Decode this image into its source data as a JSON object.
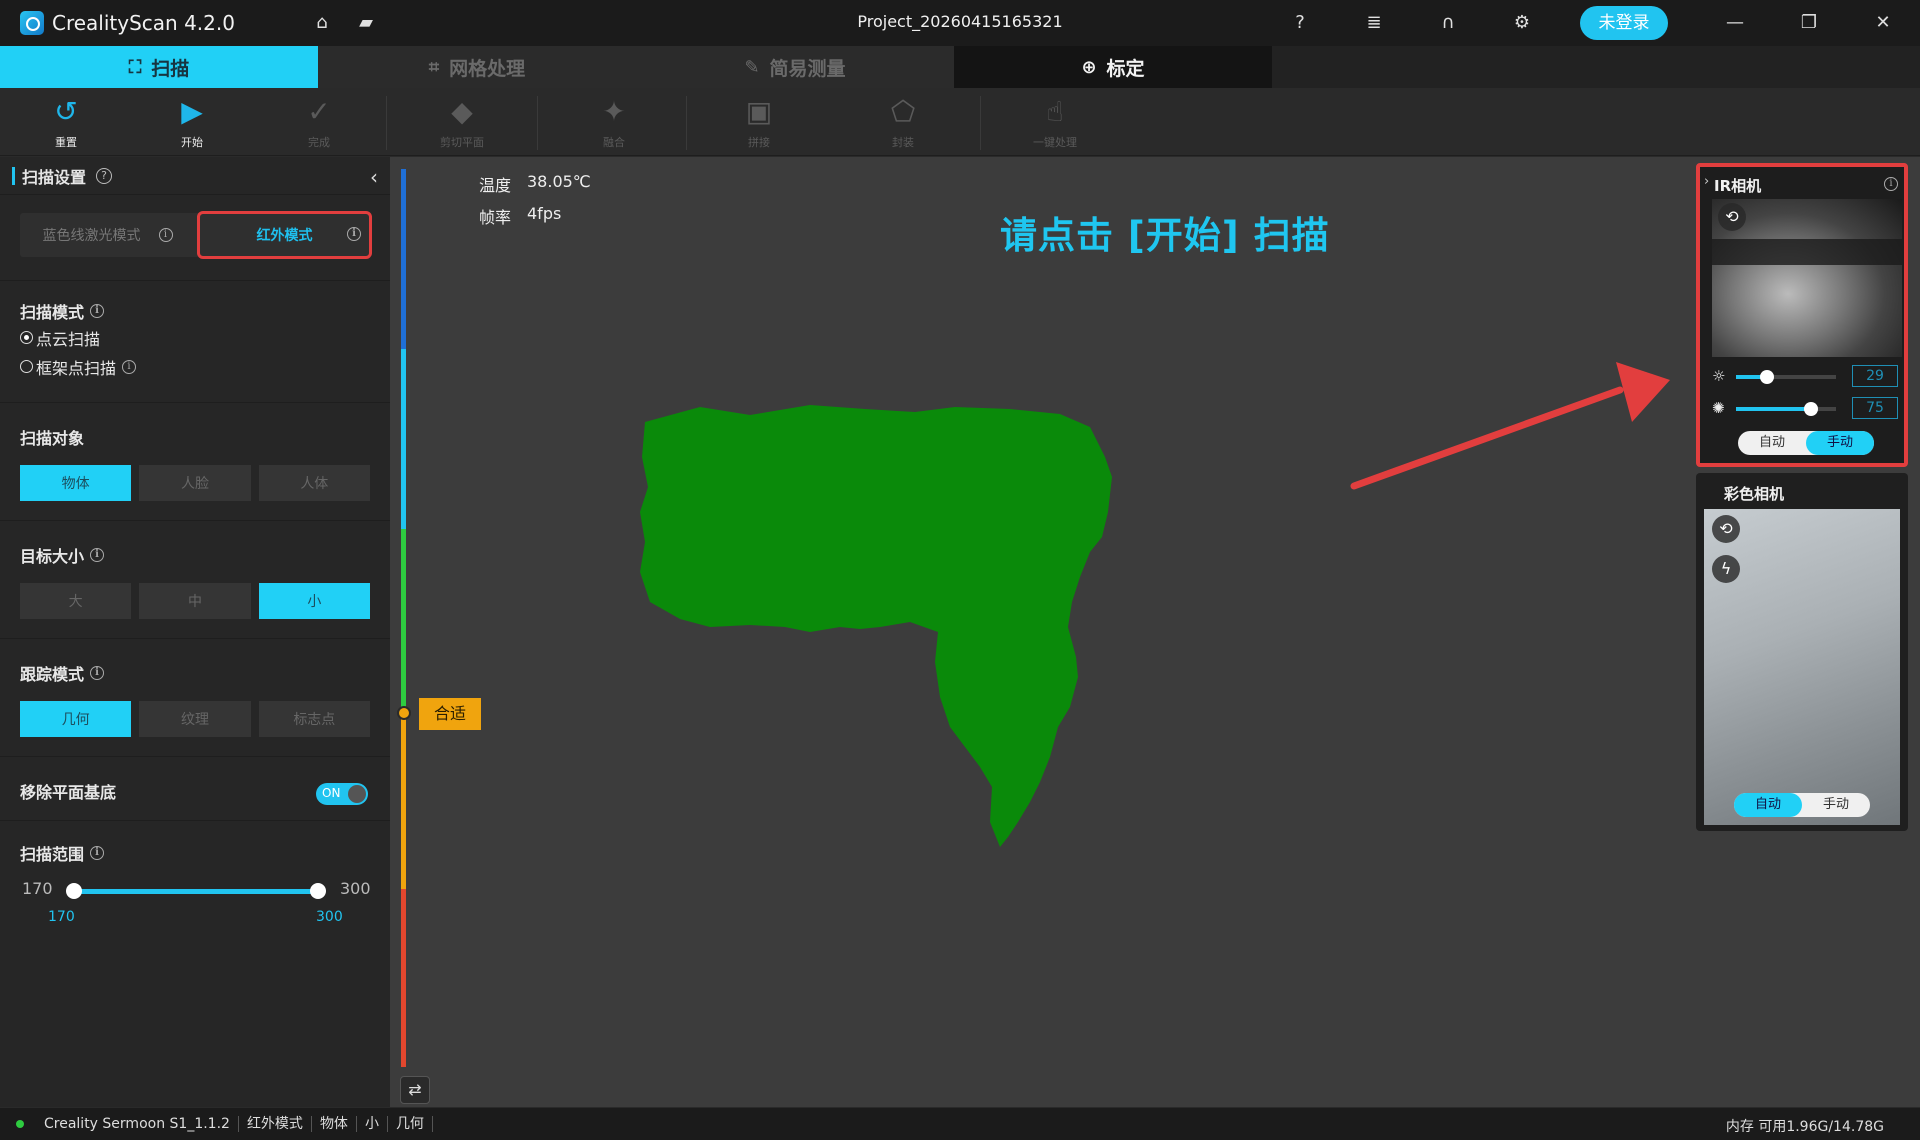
{
  "app": {
    "title": "CrealityScan 4.2.0",
    "project": "Project_20260415165321",
    "login": "未登录"
  },
  "tabs": [
    {
      "label": "扫描"
    },
    {
      "label": "网格处理"
    },
    {
      "label": "简易测量"
    },
    {
      "label": "标定"
    }
  ],
  "toolbar": {
    "reset": "重置",
    "start": "开始",
    "done": "完成",
    "cut_plane": "剪切平面",
    "fuse": "融合",
    "stitch": "拼接",
    "mesh": "封装",
    "one_key": "一键处理"
  },
  "left": {
    "title": "扫描设置",
    "mode_blue": "蓝色线激光模式",
    "mode_ir": "红外模式",
    "scan_mode_title": "扫描模式",
    "scan_mode_opts": [
      "点云扫描",
      "框架点扫描"
    ],
    "target_title": "扫描对象",
    "target_opts": [
      "物体",
      "人脸",
      "人体"
    ],
    "size_title": "目标大小",
    "size_opts": [
      "大",
      "中",
      "小"
    ],
    "track_title": "跟踪模式",
    "track_opts": [
      "几何",
      "纹理",
      "标志点"
    ],
    "remove_plane": "移除平面基底",
    "toggle_on": "ON",
    "range_title": "扫描范围",
    "range_min": "170",
    "range_max": "300",
    "range_low": "170",
    "range_high": "300"
  },
  "view": {
    "temp_label": "温度",
    "temp_value": "38.05℃",
    "fps_label": "帧率",
    "fps_value": "4fps",
    "hint": "请点击 [开始] 扫描",
    "distance_tag": "合适"
  },
  "right": {
    "ir_title": "IR相机",
    "ir_exposure": "29",
    "ir_gain": "75",
    "auto": "自动",
    "manual": "手动",
    "color_title": "彩色相机"
  },
  "status": {
    "device": "Creality Sermoon S1_1.1.2",
    "mode": "红外模式",
    "object": "物体",
    "size": "小",
    "track": "几何",
    "memory": "内存 可用1.96G/14.78G"
  },
  "colors": {
    "accent": "#21d0f6",
    "highlight": "#e23e3e",
    "pointcloud": "#0a8a0a",
    "warn": "#f0a40e"
  },
  "icons": [
    "home-icon",
    "folder-icon",
    "help-icon",
    "notes-icon",
    "headset-icon",
    "gear-icon",
    "rotate-icon",
    "flash-off-icon",
    "sun-icon",
    "swap-icon"
  ]
}
